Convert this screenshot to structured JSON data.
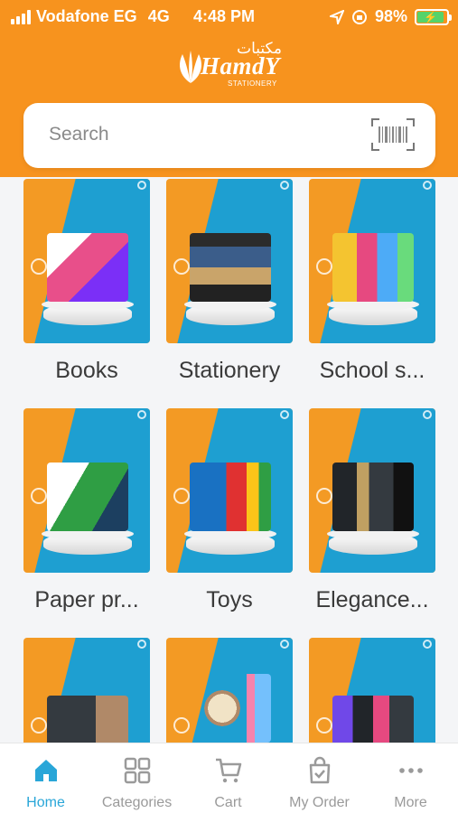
{
  "status_bar": {
    "carrier": "Vodafone EG",
    "network": "4G",
    "time": "4:48 PM",
    "battery": "98%"
  },
  "header": {
    "logo_arabic": "مكتبات",
    "logo_text": "HamdY",
    "logo_sub": "STATIONERY"
  },
  "search": {
    "placeholder": "Search",
    "icon": "barcode-scan-icon"
  },
  "colors": {
    "header": "#f7931e",
    "accent": "#29a6d8",
    "tile_orange": "#f39a24",
    "tile_blue": "#1e9fd1"
  },
  "categories": [
    {
      "label": "Books",
      "product_color": "#e84f8a"
    },
    {
      "label": "Stationery",
      "product_color": "#3b5d8a"
    },
    {
      "label": "School s...",
      "product_color": "#f4c430"
    },
    {
      "label": "Paper pr...",
      "product_color": "#2f9e44"
    },
    {
      "label": "Toys",
      "product_color": "#e03131"
    },
    {
      "label": "Elegance...",
      "product_color": "#343a40"
    },
    {
      "label": "",
      "product_color": "#495057"
    },
    {
      "label": "",
      "product_color": "#b08968"
    },
    {
      "label": "",
      "product_color": "#7048e8"
    }
  ],
  "nav": {
    "items": [
      {
        "label": "Home",
        "icon": "home-icon",
        "active": true
      },
      {
        "label": "Categories",
        "icon": "categories-grid-icon",
        "active": false
      },
      {
        "label": "Cart",
        "icon": "cart-icon",
        "active": false
      },
      {
        "label": "My Order",
        "icon": "shopping-bag-check-icon",
        "active": false
      },
      {
        "label": "More",
        "icon": "more-dots-icon",
        "active": false
      }
    ]
  }
}
